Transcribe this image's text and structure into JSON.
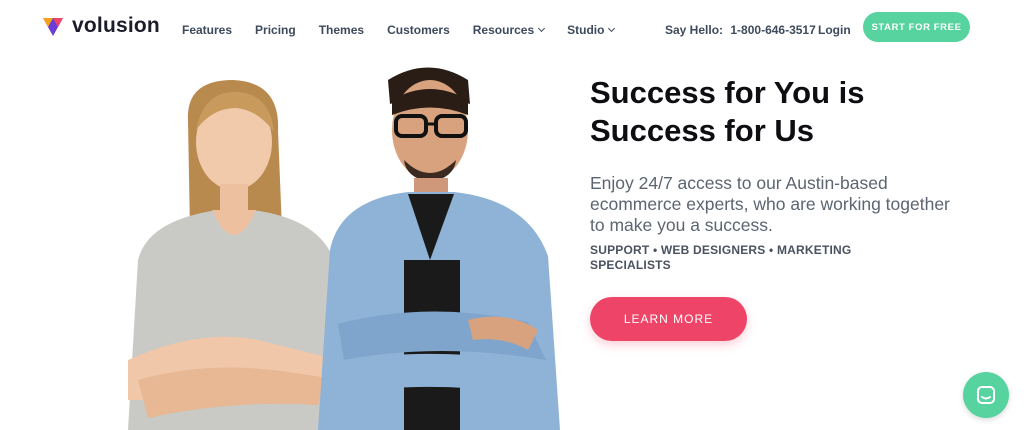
{
  "brand": {
    "name": "volusion",
    "colors": {
      "accent": "#57d39f",
      "cta": "#ee4468",
      "logo_purple": "#6b3cd6",
      "logo_orange": "#f7a21b",
      "logo_pink": "#ee4468"
    }
  },
  "nav": {
    "items": [
      {
        "label": "Features",
        "dropdown": false
      },
      {
        "label": "Pricing",
        "dropdown": false
      },
      {
        "label": "Themes",
        "dropdown": false
      },
      {
        "label": "Customers",
        "dropdown": false
      },
      {
        "label": "Resources",
        "dropdown": true
      },
      {
        "label": "Studio",
        "dropdown": true
      }
    ],
    "say_hello_label": "Say Hello:",
    "phone": "1-800-646-3517",
    "login_label": "Login",
    "start_label": "START FOR FREE"
  },
  "hero": {
    "headline_line1": "Success for You is",
    "headline_line2": "Success for Us",
    "subtext": "Enjoy 24/7 access to our Austin-based ecommerce experts, who are working together to make you a success.",
    "tags": "SUPPORT • WEB DESIGNERS • MARKETING SPECIALISTS",
    "learn_more_label": "LEARN MORE"
  },
  "chat": {
    "icon": "chat-bubble-icon"
  }
}
